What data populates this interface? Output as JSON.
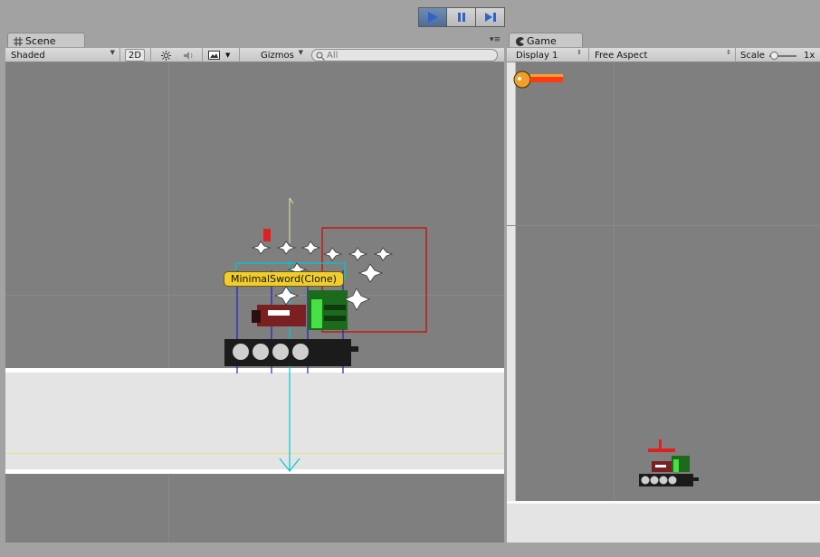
{
  "play_controls": {
    "play_icon": "play-icon",
    "pause_icon": "pause-icon",
    "step_icon": "step-icon"
  },
  "scene": {
    "tab_label": "Scene",
    "tab_icon": "grid-icon",
    "shading_mode": "Shaded",
    "mode_2d": "2D",
    "lighting_icon": "sun-icon",
    "audio_icon": "speaker-icon",
    "effects_icon": "image-icon",
    "gizmos_label": "Gizmos",
    "search_placeholder": "All",
    "menu_icon": "panel-menu-icon",
    "selected_object_label": "MinimalSword(Clone)"
  },
  "game": {
    "tab_label": "Game",
    "tab_icon": "pacman-icon",
    "display": "Display 1",
    "aspect": "Free Aspect",
    "scale_label": "Scale",
    "scale_value": "1x"
  },
  "colors": {
    "accent": "#4e6d96",
    "selection_box": "#d40000",
    "collider": "#00c8d8",
    "tag": "#f0cd2c"
  }
}
